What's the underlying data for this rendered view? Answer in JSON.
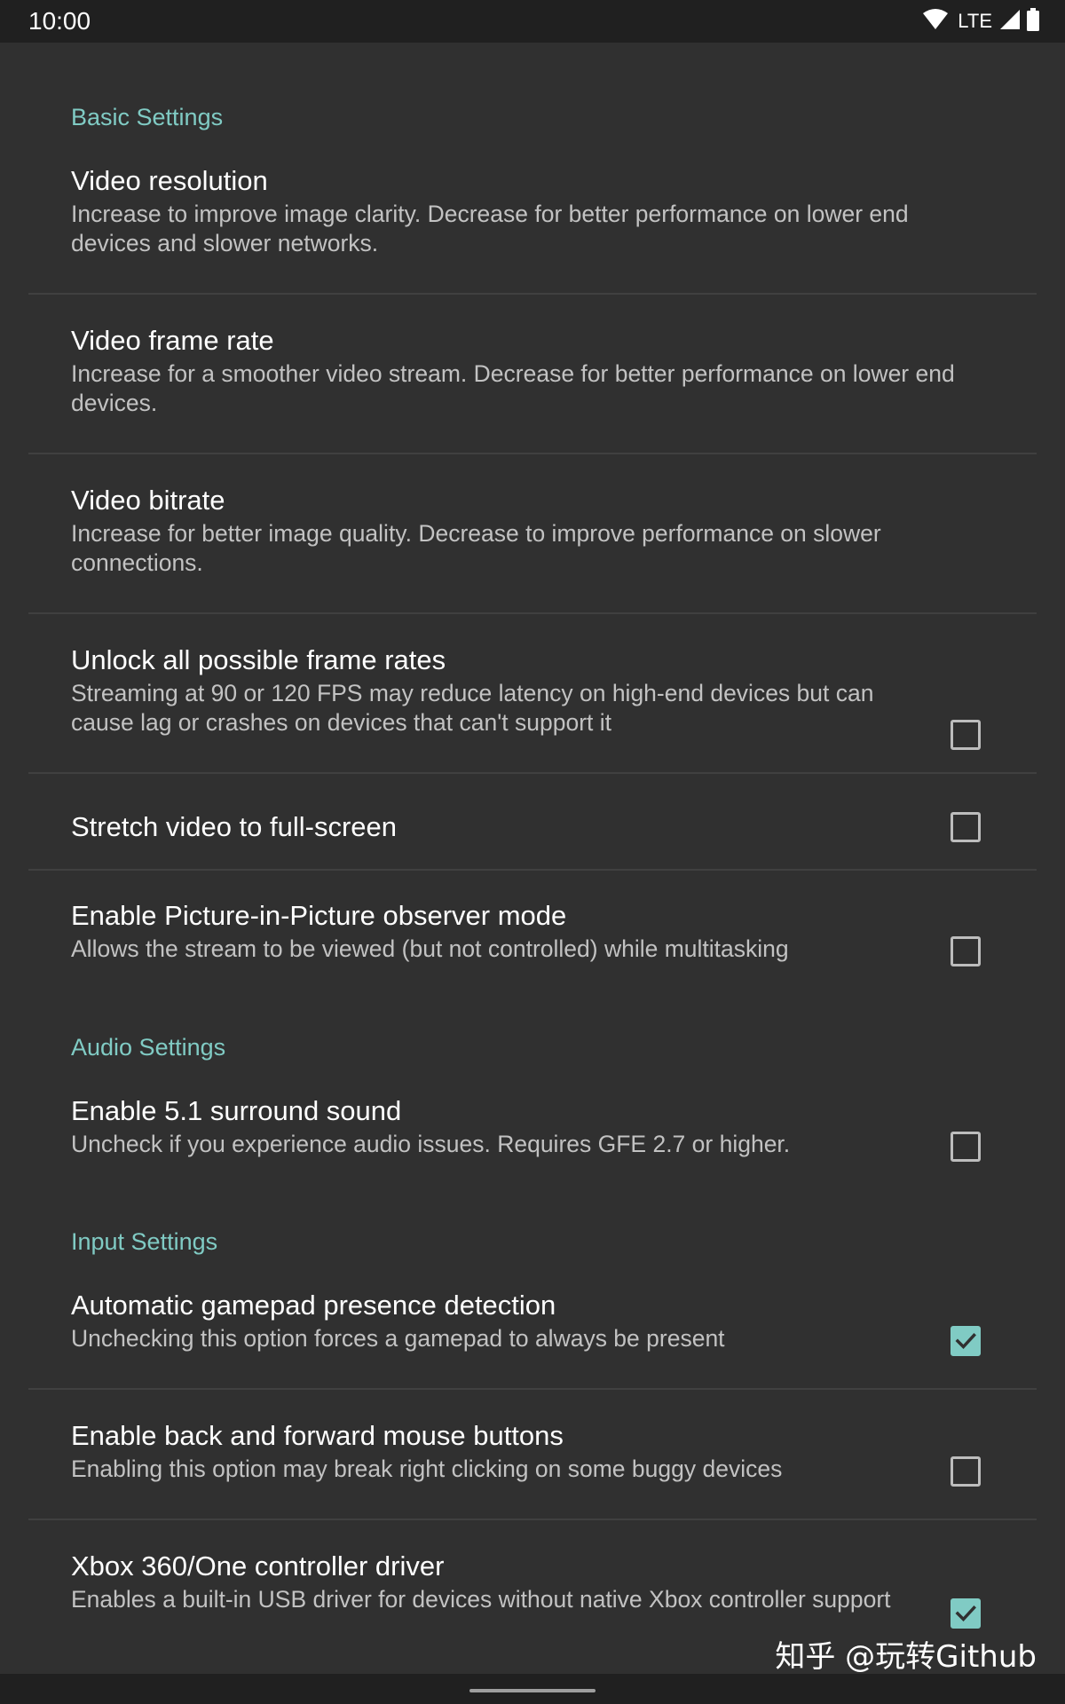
{
  "status_bar": {
    "time": "10:00",
    "network": "LTE",
    "icons": [
      "wifi-icon",
      "cell-signal-icon",
      "battery-icon"
    ]
  },
  "sections": [
    {
      "header": "Basic Settings",
      "items": [
        {
          "title": "Video resolution",
          "summary": "Increase to improve image clarity. Decrease for better performance on lower end devices and slower networks."
        },
        {
          "title": "Video frame rate",
          "summary": "Increase for a smoother video stream. Decrease for better performance on lower end devices."
        },
        {
          "title": "Video bitrate",
          "summary": "Increase for better image quality. Decrease to improve performance on slower connections."
        },
        {
          "title": "Unlock all possible frame rates",
          "summary": "Streaming at 90 or 120 FPS may reduce latency on high-end devices but can cause lag or crashes on devices that can't support it",
          "checked": false
        },
        {
          "title": "Stretch video to full-screen",
          "checked": false
        },
        {
          "title": "Enable Picture-in-Picture observer mode",
          "summary": "Allows the stream to be viewed (but not controlled) while multitasking",
          "checked": false
        }
      ]
    },
    {
      "header": "Audio Settings",
      "items": [
        {
          "title": "Enable 5.1 surround sound",
          "summary": "Uncheck if you experience audio issues. Requires GFE 2.7 or higher.",
          "checked": false
        }
      ]
    },
    {
      "header": "Input Settings",
      "items": [
        {
          "title": "Automatic gamepad presence detection",
          "summary": "Unchecking this option forces a gamepad to always be present",
          "checked": true
        },
        {
          "title": "Enable back and forward mouse buttons",
          "summary": "Enabling this option may break right clicking on some buggy devices",
          "checked": false
        },
        {
          "title": "Xbox 360/One controller driver",
          "summary": "Enables a built-in USB driver for devices without native Xbox controller support",
          "checked": true
        }
      ]
    }
  ],
  "watermark": "知乎 @玩转Github",
  "colors": {
    "background": "#303030",
    "bars": "#202020",
    "accent": "#80cbc4",
    "summary_text": "#c2c2c2",
    "divider": "#404040"
  }
}
